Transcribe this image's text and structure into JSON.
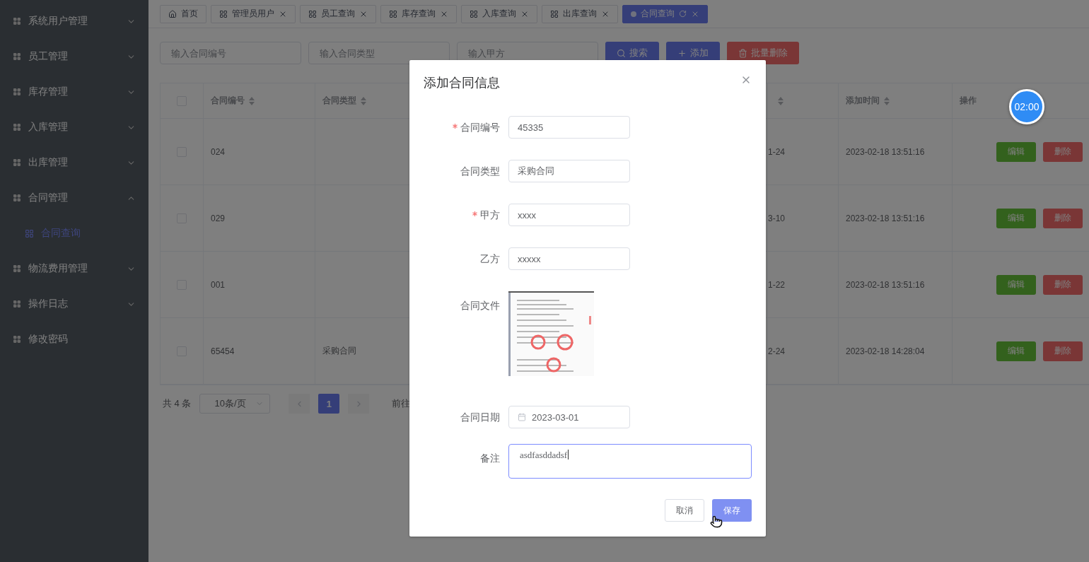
{
  "sidebar": {
    "items": [
      {
        "label": "系统用户管理",
        "expanded": false
      },
      {
        "label": "员工管理",
        "expanded": false
      },
      {
        "label": "库存管理",
        "expanded": false
      },
      {
        "label": "入库管理",
        "expanded": false
      },
      {
        "label": "出库管理",
        "expanded": false
      },
      {
        "label": "合同管理",
        "expanded": true,
        "children": [
          {
            "label": "合同查询",
            "selected": true
          }
        ]
      },
      {
        "label": "物流费用管理",
        "expanded": false
      },
      {
        "label": "操作日志",
        "expanded": false
      },
      {
        "label": "修改密码"
      }
    ]
  },
  "tabs": [
    {
      "label": "首页",
      "kind": "home",
      "selected": false
    },
    {
      "label": "管理员用户",
      "kind": "page",
      "selected": false
    },
    {
      "label": "员工查询",
      "kind": "page",
      "selected": false
    },
    {
      "label": "库存查询",
      "kind": "page",
      "selected": false
    },
    {
      "label": "入库查询",
      "kind": "page",
      "selected": false
    },
    {
      "label": "出库查询",
      "kind": "page",
      "selected": false
    },
    {
      "label": "合同查询",
      "kind": "page",
      "selected": true
    }
  ],
  "search": {
    "fields": [
      {
        "placeholder": "输入合同编号"
      },
      {
        "placeholder": "输入合同类型"
      },
      {
        "placeholder": "输入甲方"
      }
    ],
    "buttons": [
      {
        "label": "搜索",
        "kind": "search"
      },
      {
        "label": "添加",
        "kind": "add"
      },
      {
        "label": "批量删除",
        "kind": "delete"
      }
    ]
  },
  "table": {
    "header_checked": false,
    "columns": [
      {
        "label": "合同编号",
        "sortable": true
      },
      {
        "label": "合同类型",
        "sortable": true
      },
      {
        "sortable": true
      },
      {
        "label": "添加时间",
        "sortable": true
      },
      {
        "label": "操作",
        "sortable": false
      }
    ],
    "rows": [
      {
        "checked": false,
        "contract_no": "024",
        "column_4": "1-24",
        "added_at": "2023-02-18 13:51:16",
        "actions": [
          "编辑",
          "删除"
        ]
      },
      {
        "checked": false,
        "contract_no": "029",
        "column_4": "3-10",
        "added_at": "2023-02-18 13:51:16",
        "actions": [
          "编辑",
          "删除"
        ]
      },
      {
        "checked": false,
        "contract_no": "001",
        "column_4": "1-22",
        "added_at": "2023-02-18 13:51:16",
        "actions": [
          "编辑",
          "删除"
        ]
      },
      {
        "checked": false,
        "contract_no": "65454",
        "contract_type": "采购合同",
        "column_4": "2-24",
        "added_at": "2023-02-18 14:28:04",
        "actions": [
          "编辑",
          "删除"
        ]
      }
    ]
  },
  "pagination": {
    "total": "共 4 条",
    "page_size": "10条/页",
    "pages": [
      {
        "label": "1",
        "selected": true
      }
    ],
    "goto": "前往"
  },
  "timer": "02:00",
  "dialog": {
    "title": "添加合同信息",
    "fields": [
      {
        "label": "合同编号",
        "required": true,
        "kind": "text",
        "value": "45335"
      },
      {
        "label": "合同类型",
        "required": false,
        "kind": "text",
        "value": "采购合同"
      },
      {
        "label": "甲方",
        "required": true,
        "kind": "text",
        "value": "xxxx"
      },
      {
        "label": "乙方",
        "required": false,
        "kind": "text",
        "value": "xxxxx"
      },
      {
        "label": "合同文件",
        "required": false
      },
      {
        "label": "合同日期",
        "required": false,
        "kind": "date",
        "value": "2023-03-01"
      },
      {
        "label": "备注",
        "required": false,
        "kind": "textarea",
        "value": "asdfasddadsf"
      }
    ],
    "buttons": [
      {
        "label": "取消",
        "kind": "cancel"
      },
      {
        "label": "保存",
        "kind": "primary"
      }
    ]
  }
}
